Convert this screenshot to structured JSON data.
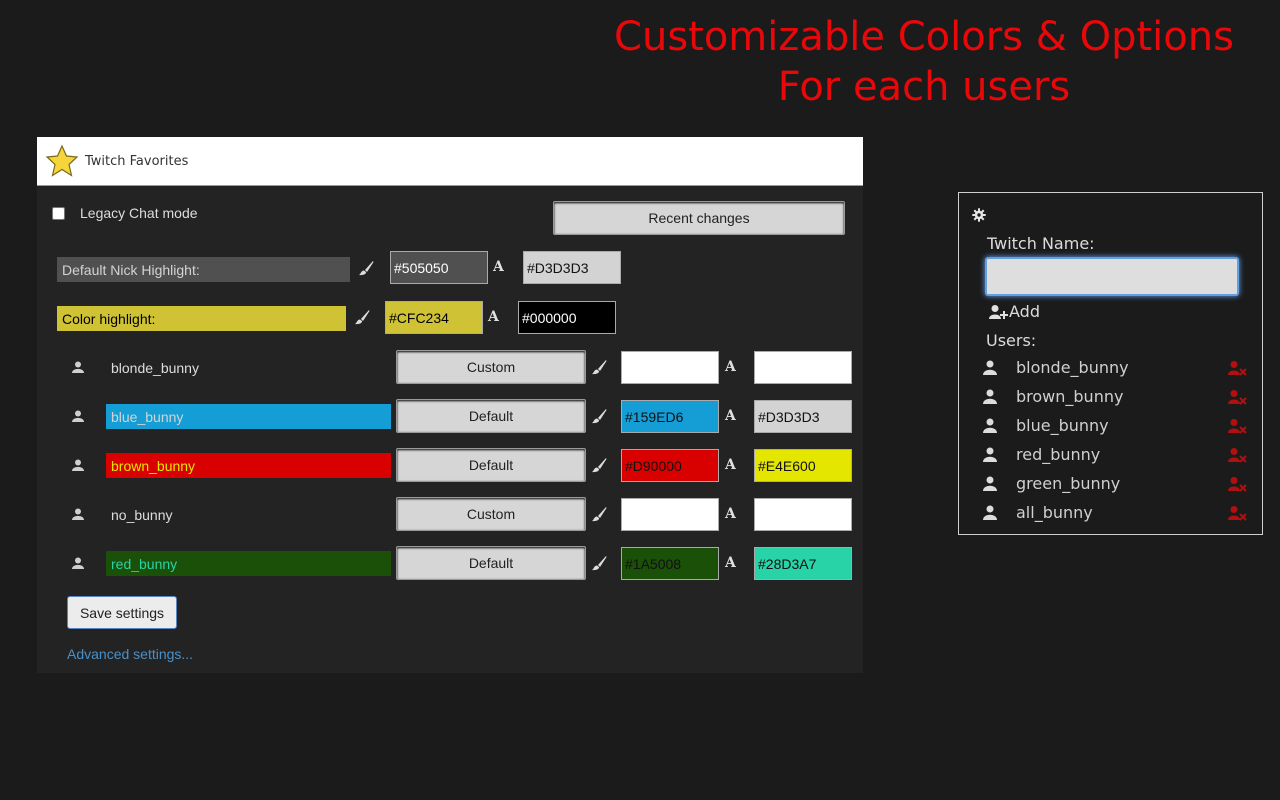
{
  "promo": {
    "line1": "Customizable Colors & Options",
    "line2": "For each users",
    "color": "#e8080a"
  },
  "header": {
    "title": "Twitch Favorites",
    "icon": "star-icon"
  },
  "options": {
    "legacy_label": "Legacy Chat mode",
    "recent_changes_label": "Recent changes",
    "default_nick": {
      "label": "Default Nick Highlight:",
      "bg_value": "#505050",
      "fg_value": "#D3D3D3"
    },
    "color_highlight": {
      "label": "Color highlight:",
      "bg_value": "#CFC234",
      "fg_value": "#000000"
    },
    "users": [
      {
        "name": "blonde_bunny",
        "mode": "Custom",
        "bg": "",
        "fg": "",
        "name_bg": "",
        "name_fg": "#dddddd"
      },
      {
        "name": "blue_bunny",
        "mode": "Default",
        "bg": "#159ED6",
        "fg": "#D3D3D3",
        "name_bg": "#159ED6",
        "name_fg": "#D3D3D3"
      },
      {
        "name": "brown_bunny",
        "mode": "Default",
        "bg": "#D90000",
        "fg": "#E4E600",
        "name_bg": "#D90000",
        "name_fg": "#E4E600"
      },
      {
        "name": "no_bunny",
        "mode": "Custom",
        "bg": "",
        "fg": "",
        "name_bg": "",
        "name_fg": "#dddddd"
      },
      {
        "name": "red_bunny",
        "mode": "Default",
        "bg": "#1A5008",
        "fg": "#28D3A7",
        "name_bg": "#1A5008",
        "name_fg": "#28D3A7"
      }
    ],
    "save_label": "Save settings",
    "advanced_label": "Advanced settings..."
  },
  "popup": {
    "settings_icon": "gear-icon",
    "twitch_name_label": "Twitch Name:",
    "name_value": "",
    "add_label": "Add",
    "users_label": "Users:",
    "users": [
      "blonde_bunny",
      "brown_bunny",
      "blue_bunny",
      "red_bunny",
      "green_bunny",
      "all_bunny"
    ]
  }
}
